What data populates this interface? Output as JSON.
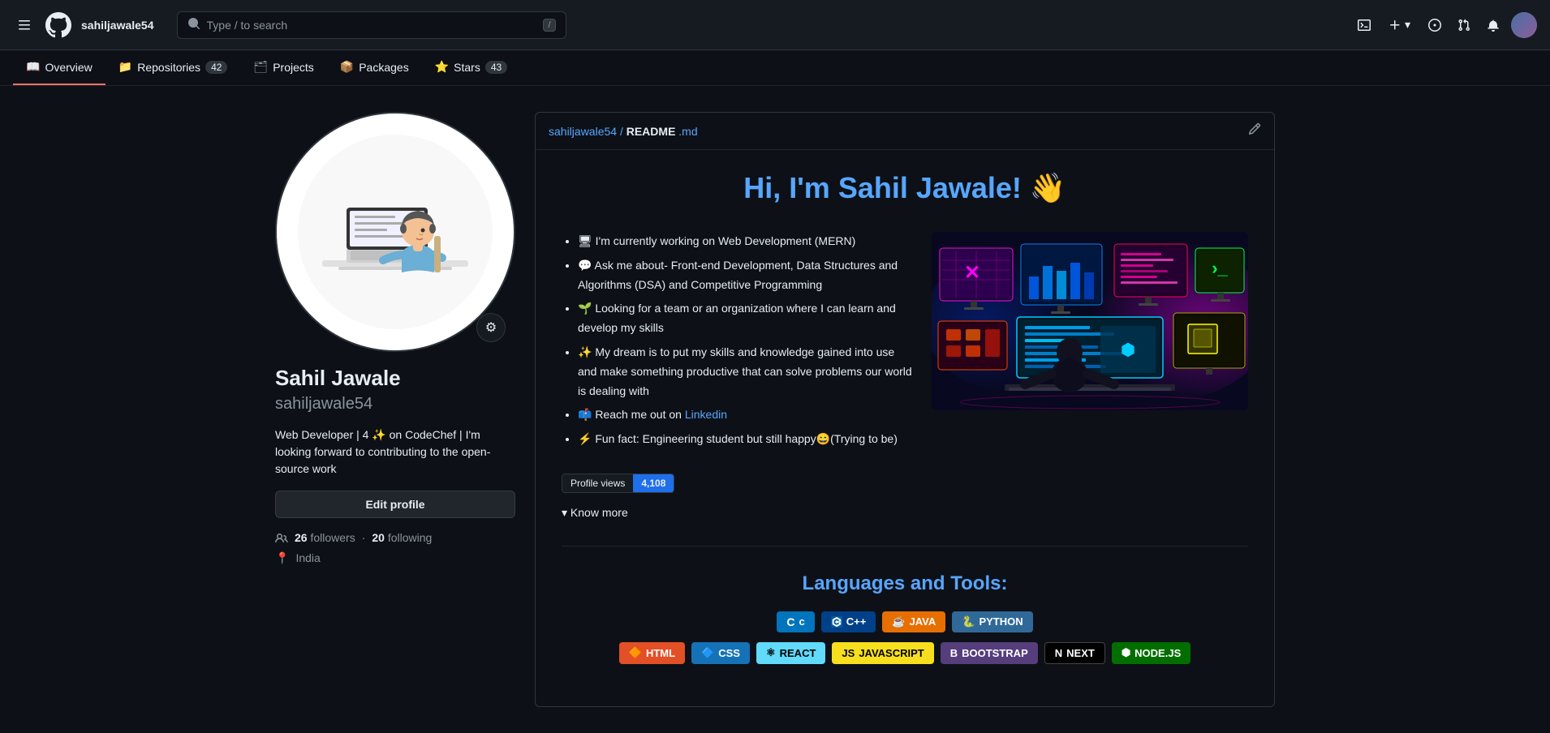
{
  "header": {
    "username": "sahiljawale54",
    "search_placeholder": "Type / to search",
    "search_shortcut": "/",
    "hamburger_label": "☰",
    "add_label": "+",
    "chevron_down": "▾"
  },
  "nav": {
    "tabs": [
      {
        "id": "overview",
        "icon": "📖",
        "label": "Overview",
        "badge": null,
        "active": true
      },
      {
        "id": "repositories",
        "icon": "📁",
        "label": "Repositories",
        "badge": "42",
        "active": false
      },
      {
        "id": "projects",
        "icon": "🗂",
        "label": "Projects",
        "badge": null,
        "active": false
      },
      {
        "id": "packages",
        "icon": "📦",
        "label": "Packages",
        "badge": null,
        "active": false
      },
      {
        "id": "stars",
        "icon": "⭐",
        "label": "Stars",
        "badge": "43",
        "active": false
      }
    ]
  },
  "profile": {
    "name": "Sahil Jawale",
    "username": "sahiljawale54",
    "bio": "Web Developer | 4 ✨ on CodeChef | I'm looking forward to contributing to the open-source work",
    "followers_count": "26",
    "followers_label": "followers",
    "following_count": "20",
    "following_label": "following",
    "location": "India",
    "edit_profile_label": "Edit profile",
    "settings_icon": "⚙"
  },
  "readme": {
    "path_user": "sahiljawale54",
    "path_separator": " / ",
    "path_file": "README",
    "path_ext": ".md",
    "edit_icon": "✏",
    "title": "Hi, I'm Sahil Jawale! 👋",
    "bullet_1": "🖥 I'm currently working on Web Development (MERN)",
    "bullet_2": "💬 Ask me about- Front-end Development, Data Structures and Algorithms (DSA) and Competitive Programming",
    "bullet_3": "🌱 Looking for a team or an organization where I can learn and develop my skills",
    "bullet_4": "✨ My dream is to put my skills and knowledge gained into use and make something productive that can solve problems our world is dealing with",
    "bullet_5_pre": "📫 Reach me out on ",
    "bullet_5_link": "Linkedin",
    "bullet_6": "⚡ Fun fact: Engineering student but still happy😄(Trying to be)",
    "profile_views_label": "Profile views",
    "profile_views_count": "4,108",
    "know_more_label": "▾ Know more",
    "languages_title": "Languages and Tools:",
    "badges": [
      {
        "label": "C",
        "icon": "C",
        "class": "badge-c"
      },
      {
        "label": "C++",
        "icon": "C++",
        "class": "badge-cpp"
      },
      {
        "label": "JAVA",
        "icon": "☕",
        "class": "badge-java"
      },
      {
        "label": "PYTHON",
        "icon": "🐍",
        "class": "badge-python"
      }
    ],
    "badges_row2": [
      {
        "label": "HTML",
        "icon": "🔶",
        "class": "badge-html"
      },
      {
        "label": "CSS",
        "icon": "🔷",
        "class": "badge-css"
      },
      {
        "label": "REACT",
        "icon": "⚛",
        "class": "badge-react"
      },
      {
        "label": "JAVASCRIPT",
        "icon": "JS",
        "class": "badge-js"
      },
      {
        "label": "BOOTSTRAP",
        "icon": "B",
        "class": "badge-bootstrap"
      },
      {
        "label": "NEXT",
        "icon": "N",
        "class": "badge-next"
      },
      {
        "label": "NODE.JS",
        "icon": "⬢",
        "class": "badge-nodejs"
      }
    ]
  }
}
